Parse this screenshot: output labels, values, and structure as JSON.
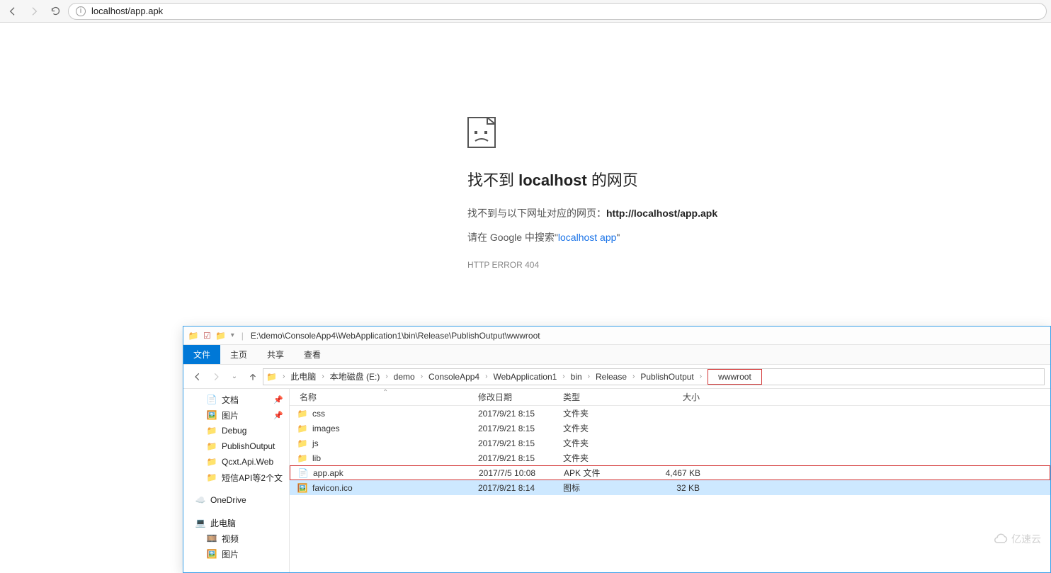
{
  "browser": {
    "url": "localhost/app.apk"
  },
  "error": {
    "title_pre": "找不到 ",
    "title_host": "localhost",
    "title_post": " 的网页",
    "line_pre": "找不到与以下网址对应的网页：",
    "line_url": "http://localhost/app.apk",
    "search_pre": "请在 Google 中搜索\"",
    "search_link": "localhost app",
    "search_post": "\"",
    "code": "HTTP ERROR 404"
  },
  "explorer": {
    "title_path": "E:\\demo\\ConsoleApp4\\WebApplication1\\bin\\Release\\PublishOutput\\wwwroot",
    "ribbon": {
      "file": "文件",
      "home": "主页",
      "share": "共享",
      "view": "查看"
    },
    "crumbs": [
      "此电脑",
      "本地磁盘 (E:)",
      "demo",
      "ConsoleApp4",
      "WebApplication1",
      "bin",
      "Release",
      "PublishOutput",
      "wwwroot"
    ],
    "side": {
      "documents": "文档",
      "pictures": "图片",
      "debug": "Debug",
      "publish": "PublishOutput",
      "qcxt": "Qcxt.Api.Web",
      "sms": "短信API等2个文",
      "onedrive": "OneDrive",
      "thispc": "此电脑",
      "videos": "视频",
      "pictures2": "图片"
    },
    "cols": {
      "name": "名称",
      "date": "修改日期",
      "type": "类型",
      "size": "大小"
    },
    "rows": [
      {
        "icon": "folder",
        "name": "css",
        "date": "2017/9/21 8:15",
        "type": "文件夹",
        "size": ""
      },
      {
        "icon": "folder",
        "name": "images",
        "date": "2017/9/21 8:15",
        "type": "文件夹",
        "size": ""
      },
      {
        "icon": "folder",
        "name": "js",
        "date": "2017/9/21 8:15",
        "type": "文件夹",
        "size": ""
      },
      {
        "icon": "folder",
        "name": "lib",
        "date": "2017/9/21 8:15",
        "type": "文件夹",
        "size": ""
      },
      {
        "icon": "file",
        "name": "app.apk",
        "date": "2017/7/5 10:08",
        "type": "APK 文件",
        "size": "4,467 KB",
        "highlight": true
      },
      {
        "icon": "ico",
        "name": "favicon.ico",
        "date": "2017/9/21 8:14",
        "type": "图标",
        "size": "32 KB",
        "selected": true
      }
    ]
  },
  "watermark": "亿速云"
}
